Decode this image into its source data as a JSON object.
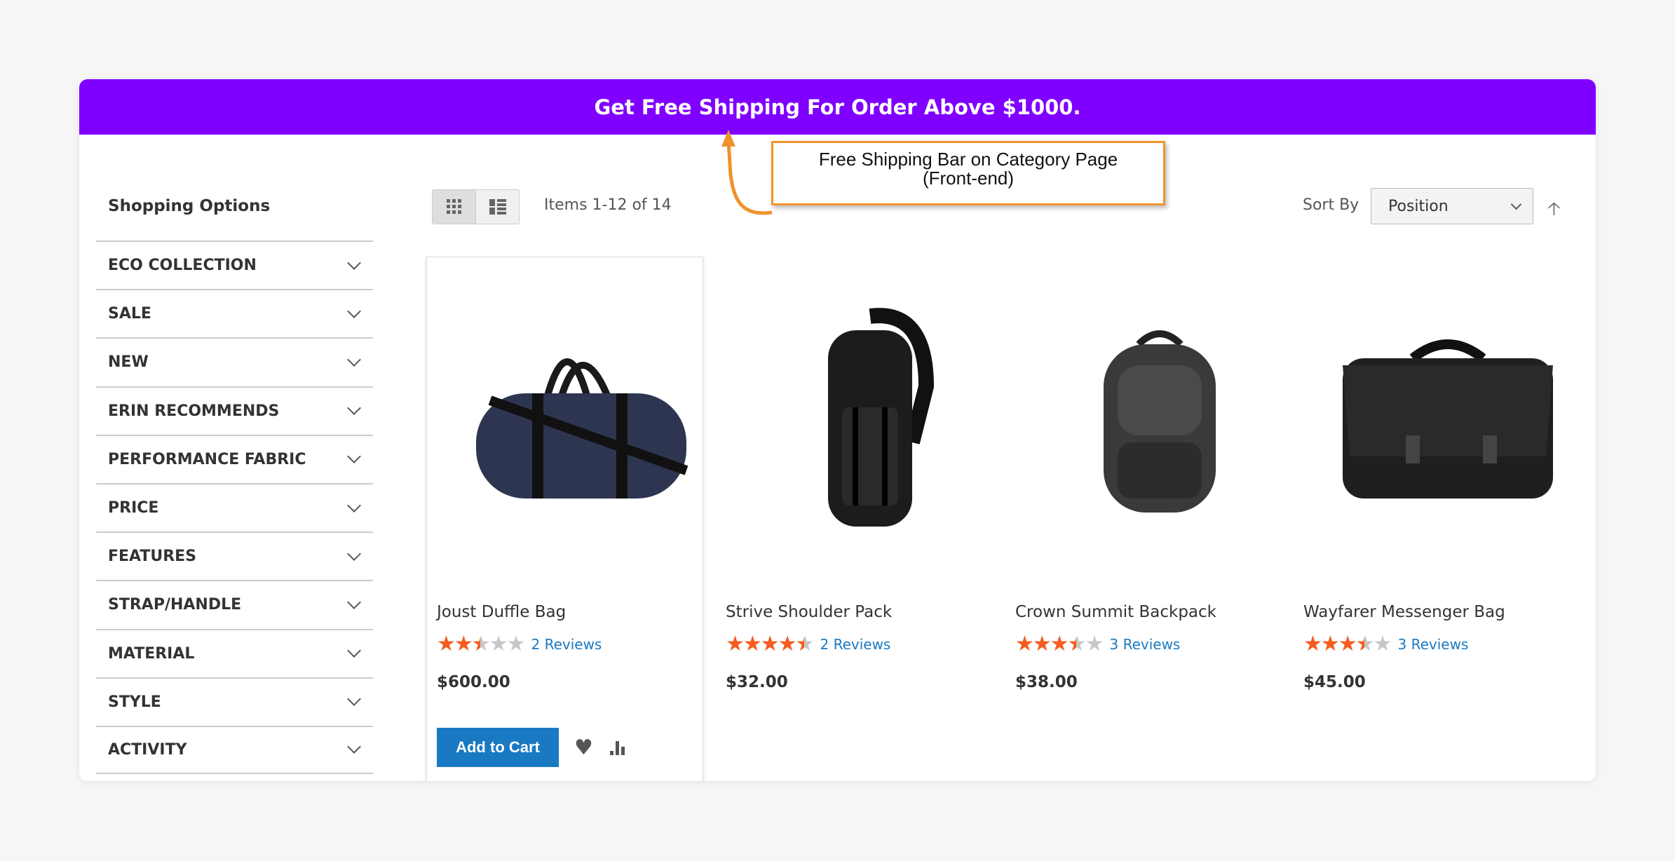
{
  "banner": {
    "text": "Get Free Shipping For Order Above $1000.",
    "color": "#8000ff"
  },
  "annotation": {
    "line1": "Free Shipping Bar on Category Page",
    "line2": "(Front-end)",
    "border_color": "#f0922b"
  },
  "sidebar": {
    "title": "Shopping Options",
    "filters": [
      "ECO COLLECTION",
      "SALE",
      "NEW",
      "ERIN RECOMMENDS",
      "PERFORMANCE FABRIC",
      "PRICE",
      "FEATURES",
      "STRAP/HANDLE",
      "MATERIAL",
      "STYLE",
      "ACTIVITY"
    ]
  },
  "toolbar": {
    "view_modes": [
      "grid",
      "list"
    ],
    "active_view": "grid",
    "items_text": "Items 1-12 of 14",
    "sort_label": "Sort By",
    "sort_value": "Position",
    "sort_direction_icon": "arrow-up-icon"
  },
  "products": [
    {
      "name": "Joust Duffle Bag",
      "rating": 2.5,
      "reviews": "2  Reviews",
      "price": "$600.00",
      "image": "duffle-bag"
    },
    {
      "name": "Strive Shoulder Pack",
      "rating": 4.5,
      "reviews": "2  Reviews",
      "price": "$32.00",
      "image": "sling-backpack"
    },
    {
      "name": "Crown Summit Backpack",
      "rating": 3.5,
      "reviews": "3  Reviews",
      "price": "$38.00",
      "image": "backpack"
    },
    {
      "name": "Wayfarer Messenger Bag",
      "rating": 3.5,
      "reviews": "3  Reviews",
      "price": "$45.00",
      "image": "messenger-bag"
    }
  ],
  "hover_actions": {
    "add_to_cart": "Add to Cart",
    "wishlist_icon": "heart-icon",
    "compare_icon": "bar-chart-icon"
  },
  "colors": {
    "star": "#f55d1e",
    "link": "#1979c3",
    "button": "#1979c3"
  }
}
